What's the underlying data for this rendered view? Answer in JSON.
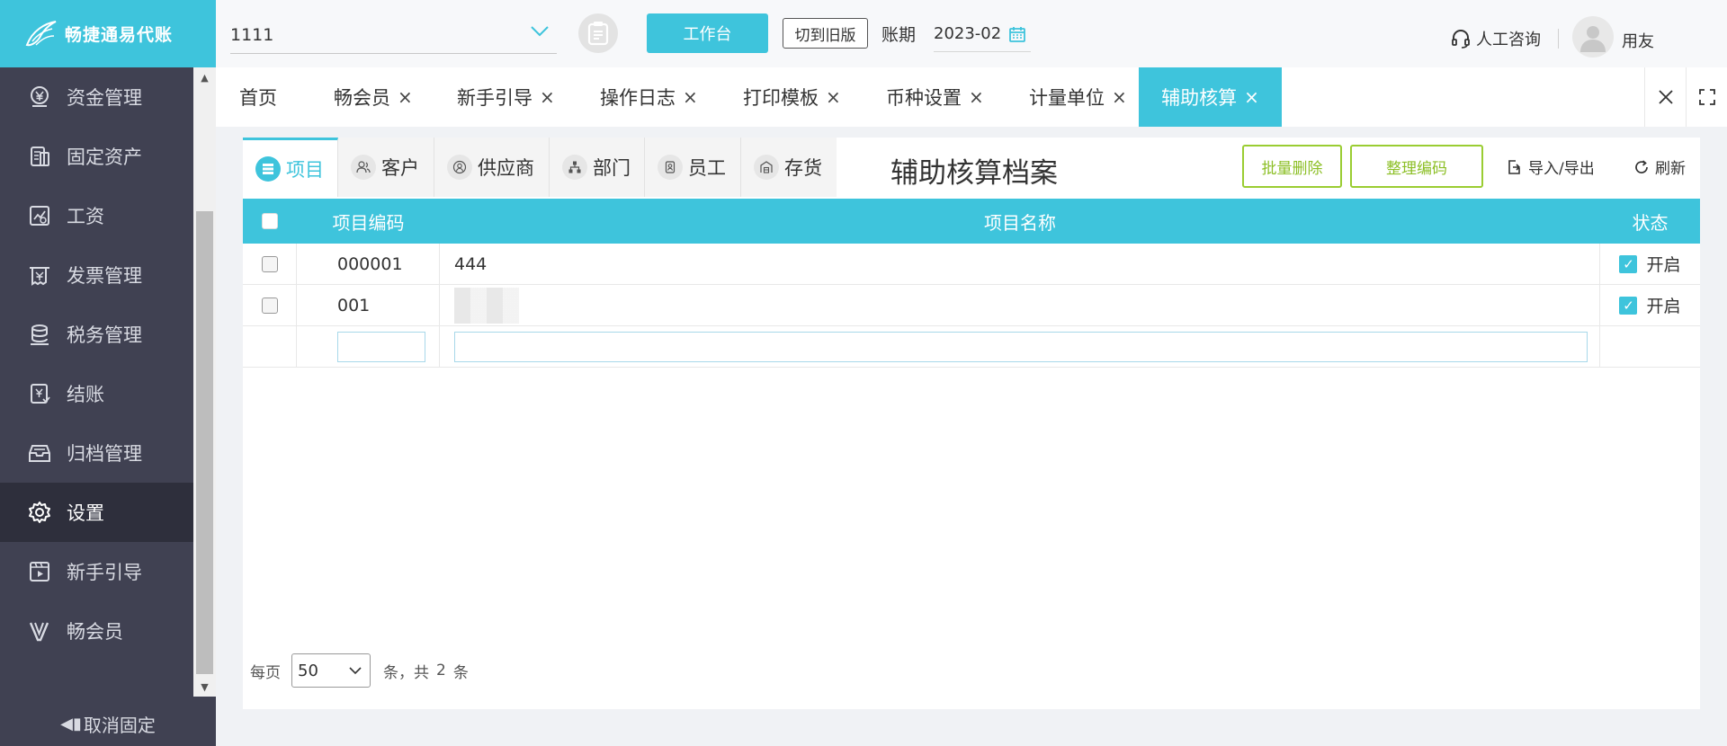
{
  "app": {
    "name": "畅捷通易代账"
  },
  "sidebar": {
    "items": [
      {
        "label": "资金管理",
        "icon": "yen-coin-icon"
      },
      {
        "label": "固定资产",
        "icon": "asset-icon"
      },
      {
        "label": "工资",
        "icon": "salary-chart-icon"
      },
      {
        "label": "发票管理",
        "icon": "invoice-icon"
      },
      {
        "label": "税务管理",
        "icon": "tax-icon"
      },
      {
        "label": "结账",
        "icon": "closing-icon"
      },
      {
        "label": "归档管理",
        "icon": "archive-icon"
      },
      {
        "label": "设置",
        "icon": "gear-icon",
        "active": true
      },
      {
        "label": "新手引导",
        "icon": "video-guide-icon"
      },
      {
        "label": "畅会员",
        "icon": "member-v-icon"
      }
    ],
    "unpin_label": "取消固定"
  },
  "header": {
    "company": "1111",
    "workbench_label": "工作台",
    "old_version_label": "切到旧版",
    "period_label": "账期",
    "period_value": "2023-02",
    "consult_label": "人工咨询",
    "username": "用友"
  },
  "tabs": [
    {
      "label": "首页",
      "closable": false
    },
    {
      "label": "畅会员",
      "closable": true
    },
    {
      "label": "新手引导",
      "closable": true
    },
    {
      "label": "操作日志",
      "closable": true
    },
    {
      "label": "打印模板",
      "closable": true
    },
    {
      "label": "币种设置",
      "closable": true
    },
    {
      "label": "计量单位",
      "closable": true
    },
    {
      "label": "辅助核算",
      "closable": true,
      "active": true
    }
  ],
  "tab_close_glyph": "×",
  "content": {
    "subtabs": [
      {
        "label": "项目",
        "active": true
      },
      {
        "label": "客户"
      },
      {
        "label": "供应商"
      },
      {
        "label": "部门"
      },
      {
        "label": "员工"
      },
      {
        "label": "存货"
      }
    ],
    "title": "辅助核算档案",
    "batch_delete_label": "批量删除",
    "reorganize_code_label": "整理编码",
    "import_export_label": "导入/导出",
    "refresh_label": "刷新",
    "columns": {
      "code": "项目编码",
      "name": "项目名称",
      "status": "状态"
    },
    "rows": [
      {
        "code": "000001",
        "name": "444",
        "status": "开启",
        "name_blurred": false
      },
      {
        "code": "001",
        "name": "",
        "status": "开启",
        "name_blurred": true
      }
    ],
    "pager": {
      "per_page_label": "每页",
      "per_page_value": "50",
      "total_prefix": "条，共",
      "total_count": "2",
      "total_suffix": "条"
    }
  },
  "colors": {
    "accent": "#3ec4dc",
    "sidebar_bg": "#404152",
    "sidebar_active": "#2e2f3c",
    "green_outline": "#9acd32"
  }
}
